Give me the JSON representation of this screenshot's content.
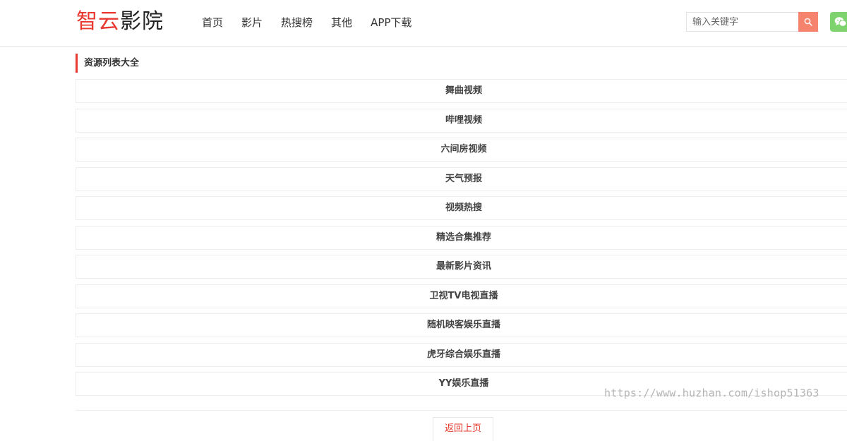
{
  "header": {
    "logo_accent": "智云",
    "logo_rest": "影院",
    "nav": [
      "首页",
      "影片",
      "热搜榜",
      "其他",
      "APP下载"
    ],
    "search_placeholder": "输入关键字"
  },
  "icons": {
    "search": "search-icon",
    "wechat": "wechat-icon"
  },
  "colors": {
    "accent": "#e8382f",
    "search_button": "#f5836e",
    "wechat_button": "#7fd36f"
  },
  "section": {
    "title": "资源列表大全"
  },
  "list": [
    "舞曲视频",
    "哔哩视频",
    "六间房视频",
    "天气预报",
    "视频热搜",
    "精选合集推荐",
    "最新影片资讯",
    "卫视TV电视直播",
    "随机映客娱乐直播",
    "虎牙综合娱乐直播",
    "YY娱乐直播"
  ],
  "footer": {
    "back_label": "返回上页"
  },
  "watermark": "https://www.huzhan.com/ishop51363"
}
